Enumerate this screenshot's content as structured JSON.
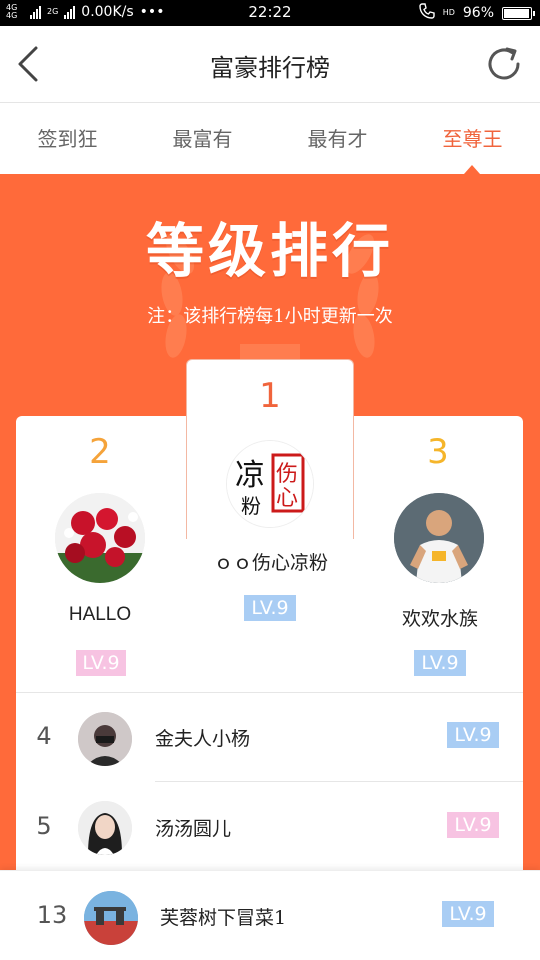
{
  "status_bar": {
    "net_left": "4G 4G",
    "net_2g": "2G",
    "speed": "0.00K/s",
    "dots": "•••",
    "time": "22:22",
    "hd": "HD",
    "battery": "96%",
    "battery_level": 0.96
  },
  "header": {
    "title": "富豪排行榜"
  },
  "tabs": [
    {
      "label": "签到狂",
      "active": false
    },
    {
      "label": "最富有",
      "active": false
    },
    {
      "label": "最有才",
      "active": false
    },
    {
      "label": "至尊王",
      "active": true
    }
  ],
  "hero": {
    "title": "等级排行",
    "note": "注：该排行榜每1小时更新一次"
  },
  "podium": {
    "first": {
      "rank": "1",
      "name": "ｏｏ伤心凉粉",
      "level": "LV.9",
      "avatar_text": [
        "凉",
        "伤",
        "粉",
        "心"
      ]
    },
    "second": {
      "rank": "2",
      "name": "HALLO",
      "level": "LV.9"
    },
    "third": {
      "rank": "3",
      "name": "欢欢水族",
      "level": "LV.9"
    }
  },
  "list": [
    {
      "rank": "4",
      "name": "金夫人小杨",
      "level": "LV.9"
    },
    {
      "rank": "5",
      "name": "汤汤圆儿",
      "level": "LV.9"
    }
  ],
  "my_rank": {
    "rank": "13",
    "name": "芙蓉树下冒菜1",
    "level": "LV.9"
  },
  "colors": {
    "accent": "#ff6a3a",
    "rank2": "#f5a33a",
    "rank1": "#f0643c",
    "rank3": "#f5b52a",
    "lv_blue": "#a9cdf4",
    "lv_pink": "#f7c3e2"
  }
}
